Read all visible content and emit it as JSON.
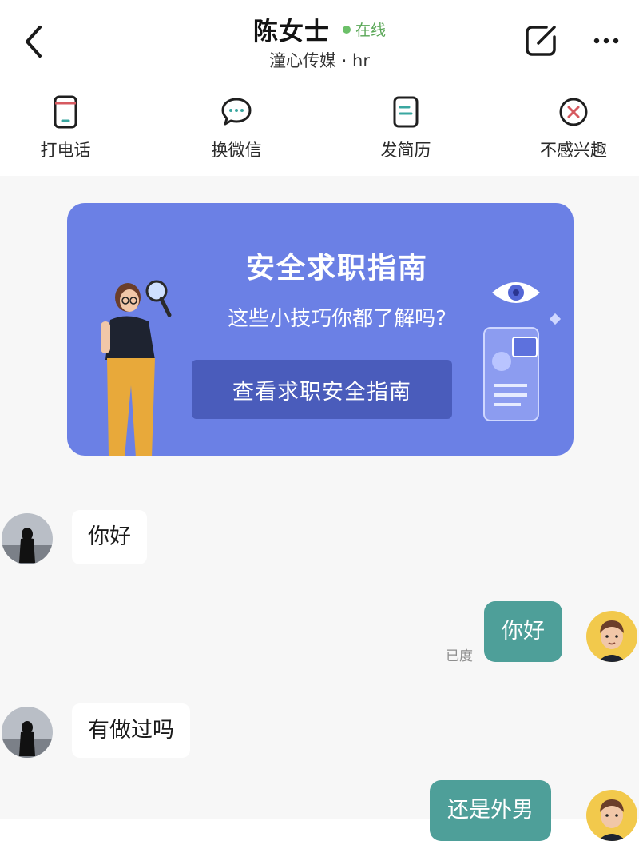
{
  "header": {
    "contact_name": "陈女士",
    "status": "在线",
    "company_role": "潼心传媒 · hr",
    "back_icon": "chevron-left-icon",
    "edit_icon": "edit-square-icon",
    "more_icon": "more-dots-icon"
  },
  "actions": [
    {
      "label": "打电话",
      "icon": "phone-icon"
    },
    {
      "label": "换微信",
      "icon": "chat-bubble-icon"
    },
    {
      "label": "发简历",
      "icon": "resume-icon"
    },
    {
      "label": "不感兴趣",
      "icon": "not-interested-icon"
    }
  ],
  "banner": {
    "title": "安全求职指南",
    "subtitle": "这些小技巧你都了解吗?",
    "button_label": "查看求职安全指南"
  },
  "messages": [
    {
      "side": "left",
      "text": "你好"
    },
    {
      "side": "right",
      "text": "你好",
      "status": "已度"
    },
    {
      "side": "left",
      "text": "有做过吗"
    },
    {
      "side": "right",
      "text": "还是外男"
    }
  ],
  "colors": {
    "accent_green": "#4e9f99",
    "online_green": "#6cc069",
    "banner_blue": "#6b80e5",
    "banner_button": "#4a5cbb",
    "icon_red": "#d65a60",
    "icon_teal": "#3aa7a0"
  }
}
